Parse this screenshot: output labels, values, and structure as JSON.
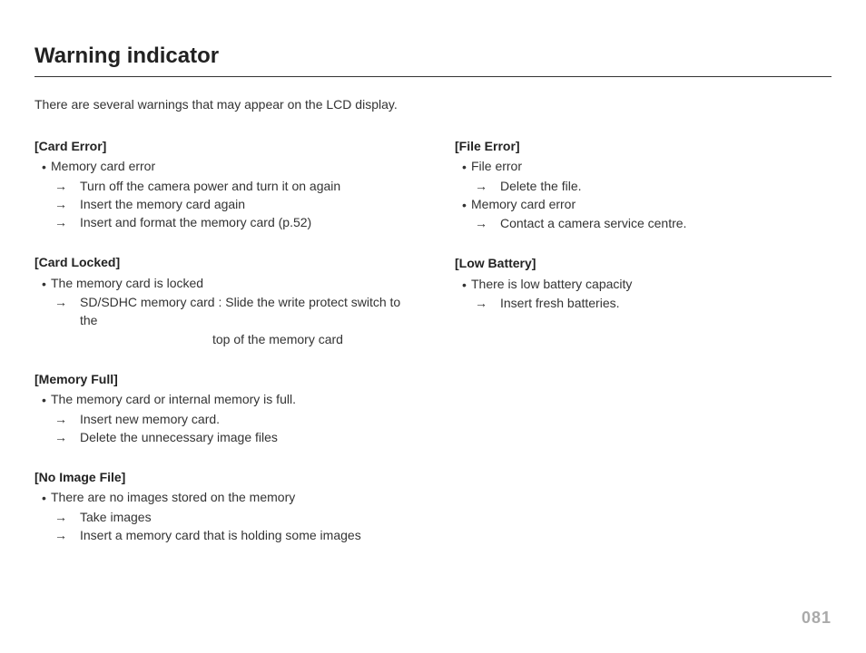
{
  "title": "Warning indicator",
  "intro": "There are several warnings that may appear on the LCD display.",
  "page_number": "081",
  "left": {
    "s1": {
      "head": "[Card Error]",
      "b1": "Memory card error",
      "a1": "Turn off the camera power and turn it on again",
      "a2": "Insert the memory card again",
      "a3": "Insert and format the memory card (p.52)"
    },
    "s2": {
      "head": "[Card Locked]",
      "b1": "The memory card is locked",
      "a1": "SD/SDHC memory card : Slide the write protect switch to the",
      "a1c": "top of the memory card"
    },
    "s3": {
      "head": "[Memory Full]",
      "b1": "The memory card or internal memory is full.",
      "a1": "Insert new memory card.",
      "a2": "Delete the unnecessary image files"
    },
    "s4": {
      "head": "[No Image File]",
      "b1": "There are no images stored on the memory",
      "a1": "Take images",
      "a2": "Insert a memory card that is holding some images"
    }
  },
  "right": {
    "s1": {
      "head": "[File Error]",
      "b1": "File error",
      "a1": "Delete the file.",
      "b2": "Memory card error",
      "a2": "Contact a camera service centre."
    },
    "s2": {
      "head": "[Low Battery]",
      "b1": "There is low battery capacity",
      "a1": "Insert fresh batteries."
    }
  }
}
